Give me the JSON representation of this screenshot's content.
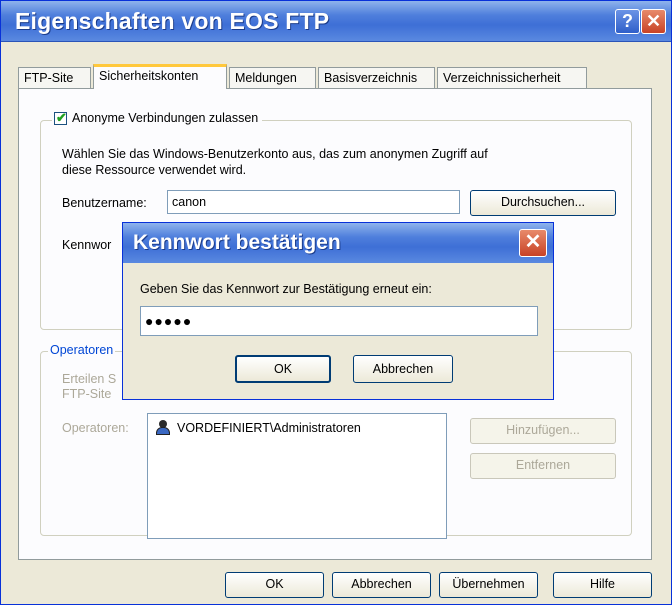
{
  "window": {
    "title": "Eigenschaften von EOS FTP",
    "help_label": "?",
    "close_label": "✕"
  },
  "tabs": [
    "FTP-Site",
    "Sicherheitskonten",
    "Meldungen",
    "Basisverzeichnis",
    "Verzeichnissicherheit"
  ],
  "active_tab": "Sicherheitskonten",
  "anonymous": {
    "checkbox_label": "Anonyme Verbindungen zulassen",
    "checked": true,
    "description_line1": "Wählen Sie das Windows-Benutzerkonto aus, das zum anonymen Zugriff auf",
    "description_line2": "diese Ressource verwendet wird.",
    "username_label": "Benutzername:",
    "username_value": "canon",
    "browse_label": "Durchsuchen...",
    "password_label": "Kennwor"
  },
  "operators": {
    "group_title": "Operatoren",
    "grant_line1": "Erteilen S",
    "grant_line2": "FTP-Site",
    "list_label": "Operatoren:",
    "items": [
      "VORDEFINIERT\\Administratoren"
    ],
    "add_label": "Hinzufügen...",
    "remove_label": "Entfernen"
  },
  "footer": {
    "ok": "OK",
    "cancel": "Abbrechen",
    "apply": "Übernehmen",
    "help": "Hilfe"
  },
  "modal": {
    "title": "Kennwort bestätigen",
    "close_label": "✕",
    "prompt": "Geben Sie das Kennwort zur Bestätigung erneut ein:",
    "password_value": "●●●●●",
    "ok": "OK",
    "cancel": "Abbrechen"
  },
  "colors": {
    "titlebar": "#3e6fd6",
    "dialog_bg": "#ece9d8",
    "tab_accent": "#ffc83c",
    "close_red": "#c84226"
  }
}
